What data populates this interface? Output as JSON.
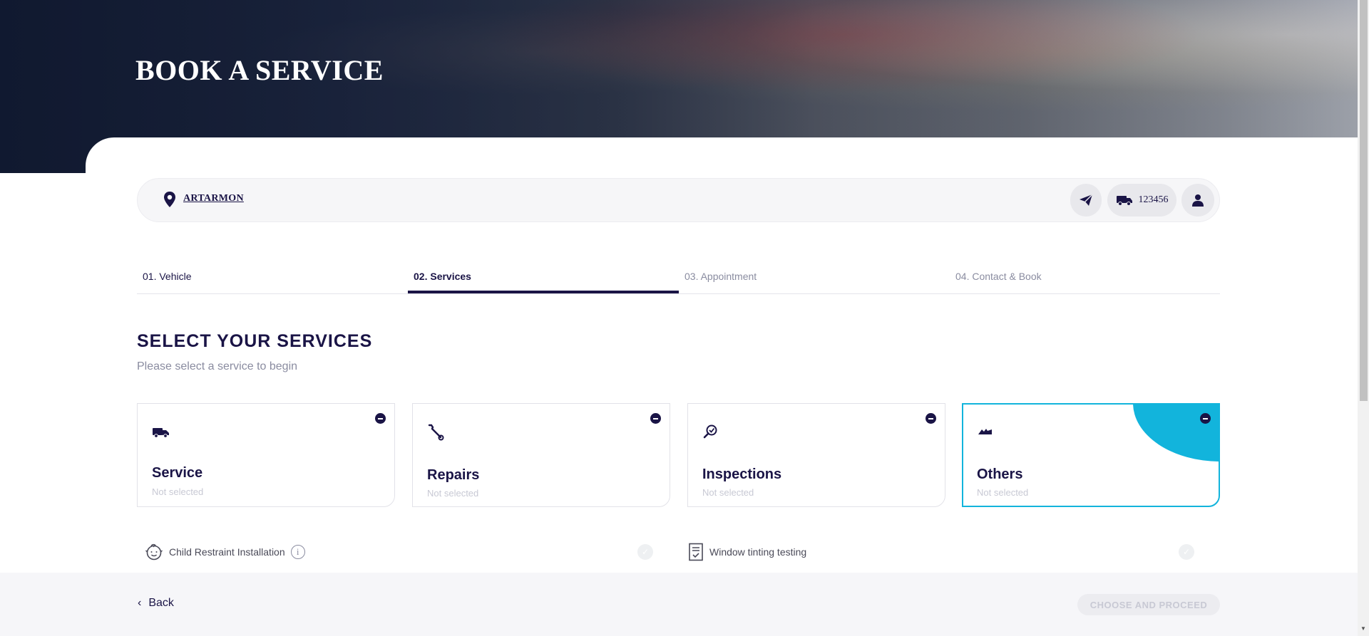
{
  "hero": {
    "title": "BOOK A SERVICE"
  },
  "location_bar": {
    "location": "ARTARMON",
    "rego": "123456"
  },
  "steps": [
    {
      "label": "01. Vehicle",
      "state": "done"
    },
    {
      "label": "02. Services",
      "state": "active"
    },
    {
      "label": "03. Appointment",
      "state": "upcoming"
    },
    {
      "label": "04. Contact & Book",
      "state": "upcoming"
    }
  ],
  "section": {
    "title": "SELECT YOUR SERVICES",
    "subtitle": "Please select a service to begin"
  },
  "cards": [
    {
      "name": "Service",
      "state": "Not selected",
      "icon": "truck-icon",
      "selected": false
    },
    {
      "name": "Repairs",
      "state": "Not selected",
      "icon": "wrench-icon",
      "selected": false
    },
    {
      "name": "Inspections",
      "state": "Not selected",
      "icon": "magnifier-check-icon",
      "selected": false
    },
    {
      "name": "Others",
      "state": "Not selected",
      "icon": "others-icon",
      "selected": true
    }
  ],
  "sub_services": [
    {
      "label": "Child Restraint Installation",
      "icon": "baby-face-icon",
      "has_info": true
    },
    {
      "label": "Window tinting testing",
      "icon": "checklist-icon",
      "has_info": false
    }
  ],
  "footer": {
    "back_label": "Back",
    "proceed_label": "CHOOSE AND PROCEED"
  },
  "colors": {
    "brand_navy": "#1a1446",
    "accent_cyan": "#12b4dc",
    "muted": "#8a8ca0"
  }
}
